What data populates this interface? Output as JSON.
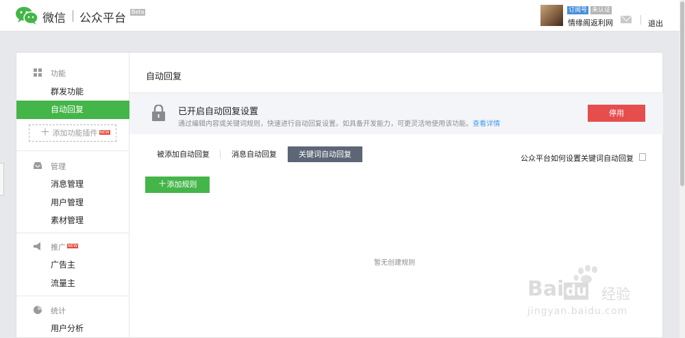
{
  "header": {
    "brand_name": "微信",
    "brand_product": "公众平台",
    "beta_tag": "Beta",
    "account_tag_type": "订阅号",
    "account_tag_verify": "未认证",
    "account_name": "情缘阁返利网",
    "logout": "退出",
    "icons": {
      "logo": "wechat-logo",
      "mail": "mail-icon"
    },
    "colors": {
      "brand_green": "#44b549"
    }
  },
  "sidebar": {
    "sections": [
      {
        "title": "功能",
        "icon": "grid-icon",
        "items": [
          "群发功能",
          "自动回复"
        ],
        "active": "自动回复",
        "add_plugin": "添加功能插件",
        "add_plugin_badge": "NEW"
      },
      {
        "title": "管理",
        "icon": "inbox-icon",
        "items": [
          "消息管理",
          "用户管理",
          "素材管理"
        ]
      },
      {
        "title": "推广",
        "icon": "megaphone-icon",
        "title_badge": "NEW",
        "items": [
          "广告主",
          "流量主"
        ]
      },
      {
        "title": "统计",
        "icon": "pie-icon",
        "items": [
          "用户分析"
        ]
      }
    ]
  },
  "main": {
    "title": "自动回复",
    "banner": {
      "title": "已开启自动回复设置",
      "desc": "通过编辑内容或关键词规则，快速进行自动回复设置。如具备开发能力，可更灵活地使用该功能。",
      "link": "查看详情",
      "stop_button": "停用",
      "icon": "lock-icon"
    },
    "tabs": [
      {
        "label": "被添加自动回复"
      },
      {
        "label": "消息自动回复"
      },
      {
        "label": "关键词自动回复",
        "active": true
      }
    ],
    "help_link": "公众平台如何设置关键词自动回复",
    "add_rule": "添加规则",
    "empty_text": "暂无创建规则"
  },
  "watermark": {
    "line1": "Bai",
    "line1_mid": "du",
    "line1_cn": "经验",
    "line2": "jingyan.baidu.com"
  }
}
